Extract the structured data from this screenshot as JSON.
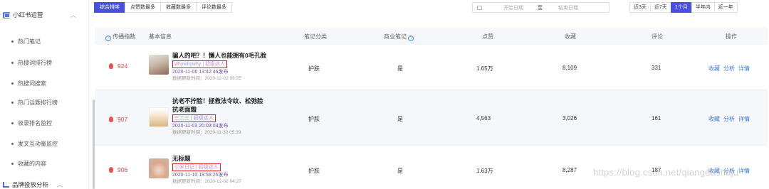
{
  "sidebar": {
    "group_label": "小红书运营",
    "items": [
      {
        "label": "热门笔记"
      },
      {
        "label": "热搜词排行榜"
      },
      {
        "label": "热搜词搜索"
      },
      {
        "label": "热门话题排行榜"
      },
      {
        "label": "收录排名监控"
      },
      {
        "label": "发文互动量监控"
      },
      {
        "label": "收藏的内容"
      }
    ],
    "group2_label": "品牌投放分析"
  },
  "sort_tabs": [
    {
      "label": "综合排序",
      "active": true
    },
    {
      "label": "点赞数最多",
      "active": false
    },
    {
      "label": "收藏数最多",
      "active": false
    },
    {
      "label": "评论数最多",
      "active": false
    }
  ],
  "date_range": {
    "start_placeholder": "开始日期",
    "separator": "至",
    "end_placeholder": "结束日期"
  },
  "period_tabs": [
    {
      "label": "近3天",
      "active": false
    },
    {
      "label": "近7天",
      "active": false
    },
    {
      "label": "1个月",
      "active": true
    },
    {
      "label": "半年内",
      "active": false
    },
    {
      "label": "近一年",
      "active": false
    }
  ],
  "table": {
    "headers": {
      "score": "传播指数",
      "basic": "基本信息",
      "category": "笔记分类",
      "commercial": "商业笔记",
      "likes": "点赞",
      "favorites": "收藏",
      "comments": "评论",
      "actions": "操作"
    },
    "rows": [
      {
        "score": "924",
        "title_lines": [
          "骗人的吧？！懒人也能拥有0毛孔脸",
          ""
        ],
        "author": "whywhywhy | 初级达人",
        "published": "2020-11-06 13:42:46发布",
        "updated": "数据更新时间：2020-12-02 05:25",
        "category": "护肤",
        "commercial": "是",
        "likes": "1.65万",
        "favorites": "8,109",
        "comments": "331"
      },
      {
        "score": "907",
        "title_lines": [
          "抗老不拧脸！拯救法令纹、松弛脸",
          "抗老面霜"
        ],
        "author": "三二三 | 初级达人",
        "published": "2020-11-03 20:03:03发布",
        "updated": "数据更新时间：2020-11-30 05:39",
        "category": "护肤",
        "commercial": "是",
        "likes": "4,563",
        "favorites": "3,026",
        "comments": "161"
      },
      {
        "score": "906",
        "title_lines": [
          "无标题",
          ""
        ],
        "author": "小米日记 | 初级达人",
        "published": "2020-11-10 18:58:25发布",
        "updated": "数据更新时间：2020-12-02 04:27",
        "category": "护肤",
        "commercial": "是",
        "likes": "1.63万",
        "favorites": "8,287",
        "comments": "187"
      }
    ],
    "action_labels": {
      "favorite": "收藏",
      "analysis": "分析",
      "detail": "详情"
    }
  },
  "watermark": "https://blog.csdn.net/qiangdashuju",
  "colors": {
    "accent": "#4a4fe0",
    "score": "#e64545",
    "link": "#3a7be0",
    "highlight_box": "#e02020"
  }
}
